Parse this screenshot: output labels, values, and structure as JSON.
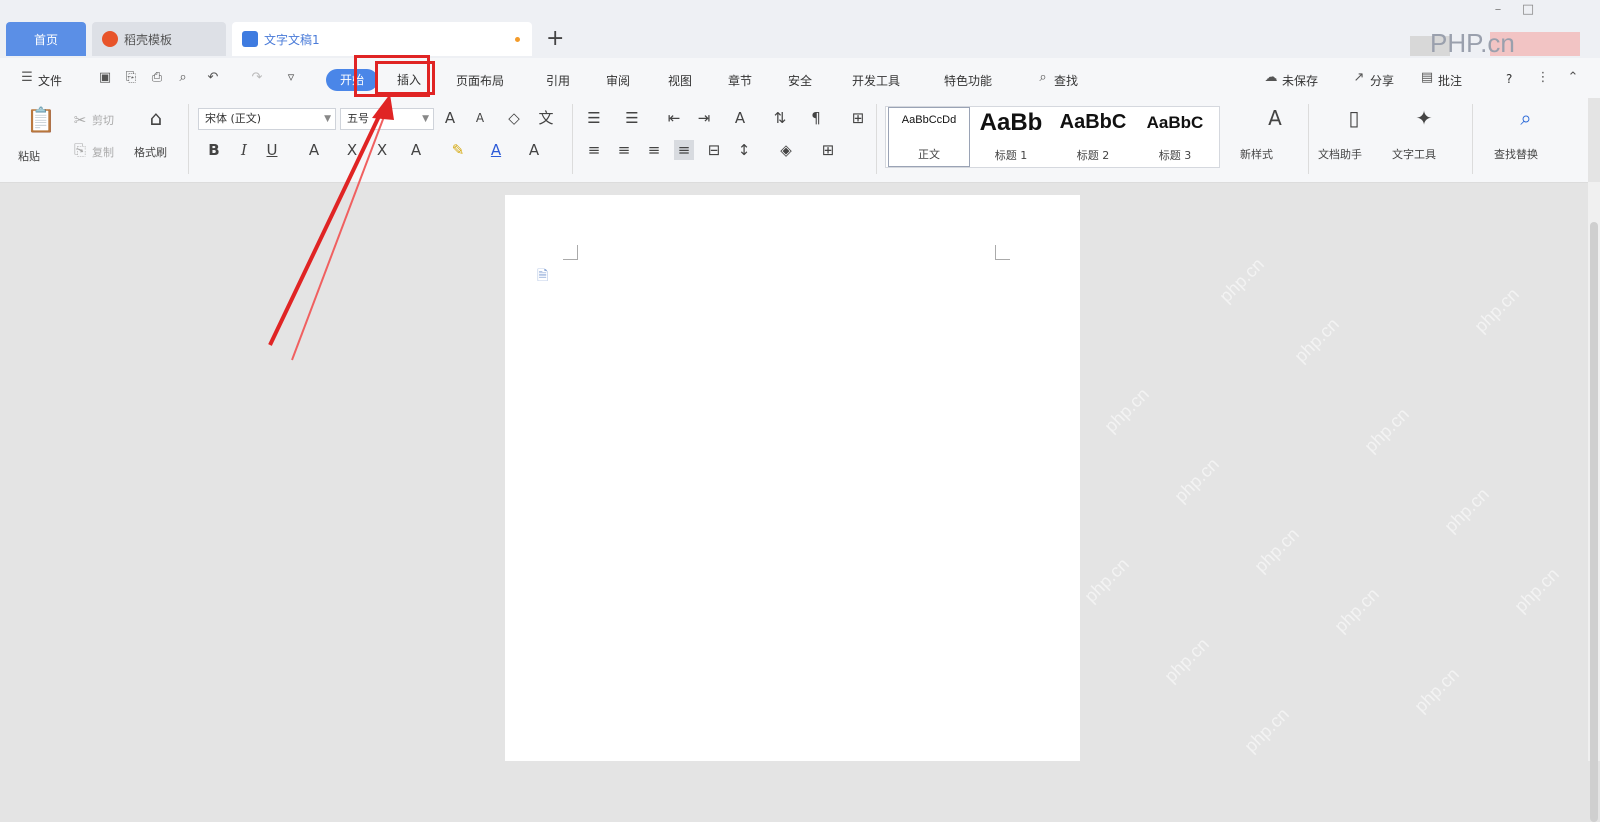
{
  "tabs": {
    "home": "首页",
    "template": "稻壳模板",
    "doc": "文字文稿1",
    "new": "+"
  },
  "watermark": "PHP.cn",
  "menu": {
    "file": "文件",
    "start": "开始",
    "insert": "插入",
    "layout": "页面布局",
    "reference": "引用",
    "review": "审阅",
    "view": "视图",
    "chapter": "章节",
    "security": "安全",
    "dev": "开发工具",
    "special": "特色功能",
    "search": "查找",
    "unsaved": "未保存",
    "share": "分享",
    "annotate": "批注",
    "help": "?"
  },
  "ribbon": {
    "paste": "粘贴",
    "cut": "剪切",
    "copy": "复制",
    "format_painter": "格式刷",
    "font": "宋体 (正文)",
    "size": "五号",
    "styles": [
      {
        "preview": "AaBbCcDd",
        "name": "正文"
      },
      {
        "preview": "AaBb",
        "name": "标题 1"
      },
      {
        "preview": "AaBbC",
        "name": "标题 2"
      },
      {
        "preview": "AaBbC",
        "name": "标题 3"
      }
    ],
    "new_style": "新样式",
    "doc_assistant": "文档助手",
    "text_tools": "文字工具",
    "find_replace": "查找替换"
  },
  "icons": {
    "menu": "hamburger-icon",
    "save": "save-icon",
    "undo": "undo-icon",
    "redo": "redo-icon",
    "search": "search-icon"
  },
  "watermark_text": "php.cn",
  "colors": {
    "accent": "#4a86e8",
    "highlight": "#e02424"
  }
}
